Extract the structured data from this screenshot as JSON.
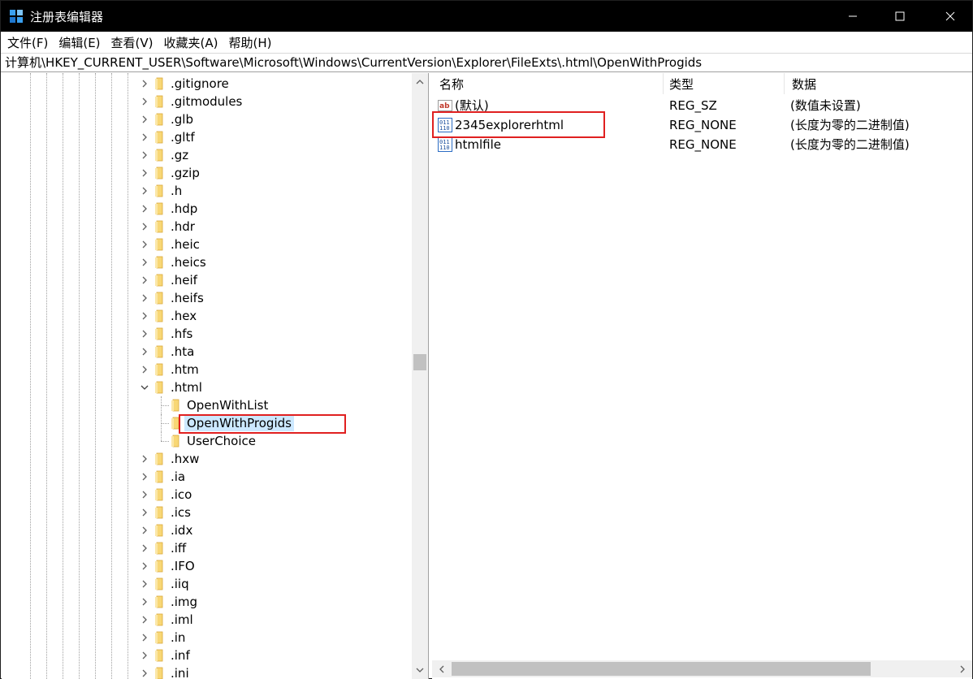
{
  "window": {
    "title": "注册表编辑器",
    "minimize_icon": "minimize-icon",
    "maximize_icon": "maximize-icon",
    "close_icon": "close-icon"
  },
  "menu": [
    "文件(F)",
    "编辑(E)",
    "查看(V)",
    "收藏夹(A)",
    "帮助(H)"
  ],
  "address": "计算机\\HKEY_CURRENT_USER\\Software\\Microsoft\\Windows\\CurrentVersion\\Explorer\\FileExts\\.html\\OpenWithProgids",
  "tree": {
    "items_before": [
      ".gitignore",
      ".gitmodules",
      ".glb",
      ".gltf",
      ".gz",
      ".gzip",
      ".h",
      ".hdp",
      ".hdr",
      ".heic",
      ".heics",
      ".heif",
      ".heifs",
      ".hex",
      ".hfs",
      ".hta",
      ".htm"
    ],
    "expanded": ".html",
    "children": [
      "OpenWithList",
      "OpenWithProgids",
      "UserChoice"
    ],
    "selected": "OpenWithProgids",
    "items_after": [
      ".hxw",
      ".ia",
      ".ico",
      ".ics",
      ".idx",
      ".iff",
      ".IFO",
      ".iiq",
      ".img",
      ".iml",
      ".in",
      ".inf",
      ".ini"
    ]
  },
  "values": {
    "columns": [
      "名称",
      "类型",
      "数据"
    ],
    "rows": [
      {
        "name": "(默认)",
        "type": "REG_SZ",
        "data": "(数值未设置)",
        "icon": "string-value-icon"
      },
      {
        "name": "2345explorerhtml",
        "type": "REG_NONE",
        "data": "(长度为零的二进制值)",
        "icon": "binary-value-icon"
      },
      {
        "name": "htmlfile",
        "type": "REG_NONE",
        "data": "(长度为零的二进制值)",
        "icon": "binary-value-icon"
      }
    ]
  },
  "colors": {
    "highlight_box": "#e02020",
    "selection": "#cce8ff",
    "folder": "#f8d775"
  }
}
